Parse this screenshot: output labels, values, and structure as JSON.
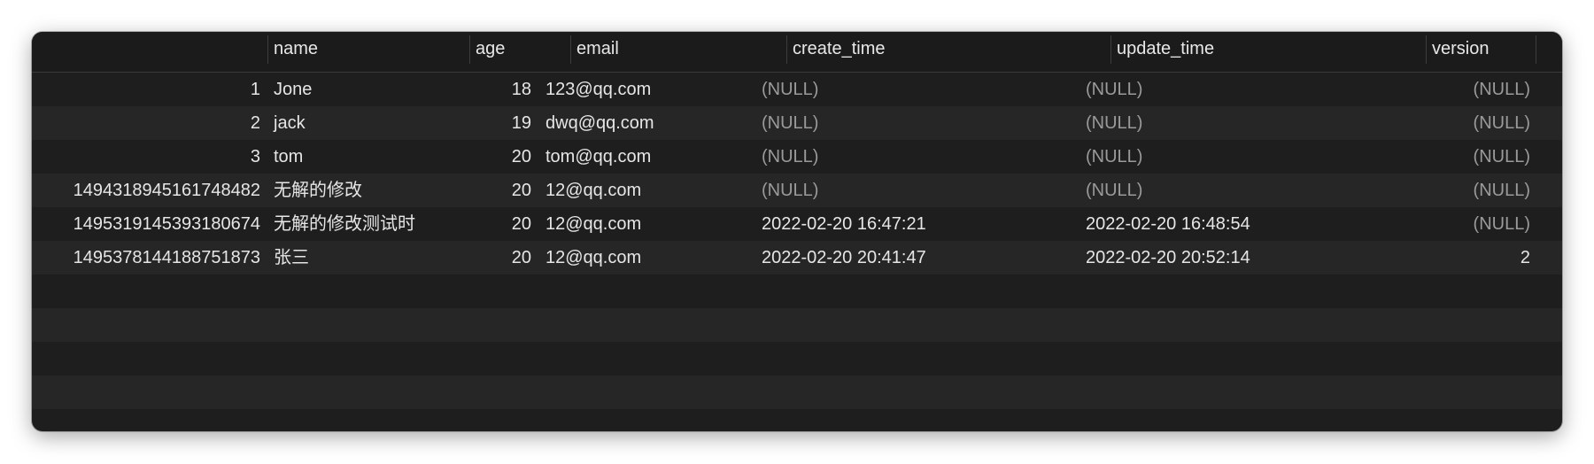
{
  "columns": [
    "",
    "name",
    "age",
    "email",
    "create_time",
    "update_time",
    "version"
  ],
  "rows": [
    {
      "id": "1",
      "name": "Jone",
      "age": "18",
      "email": "123@qq.com",
      "create_time": "(NULL)",
      "update_time": "(NULL)",
      "version": "(NULL)"
    },
    {
      "id": "2",
      "name": "jack",
      "age": "19",
      "email": "dwq@qq.com",
      "create_time": "(NULL)",
      "update_time": "(NULL)",
      "version": "(NULL)"
    },
    {
      "id": "3",
      "name": "tom",
      "age": "20",
      "email": "tom@qq.com",
      "create_time": "(NULL)",
      "update_time": "(NULL)",
      "version": "(NULL)"
    },
    {
      "id": "1494318945161748482",
      "name": "无解的修改",
      "age": "20",
      "email": "12@qq.com",
      "create_time": "(NULL)",
      "update_time": "(NULL)",
      "version": "(NULL)"
    },
    {
      "id": "1495319145393180674",
      "name": "无解的修改测试时",
      "age": "20",
      "email": "12@qq.com",
      "create_time": "2022-02-20 16:47:21",
      "update_time": "2022-02-20 16:48:54",
      "version": "(NULL)"
    },
    {
      "id": "1495378144188751873",
      "name": "张三",
      "age": "20",
      "email": "12@qq.com",
      "create_time": "2022-02-20 20:41:47",
      "update_time": "2022-02-20 20:52:14",
      "version": "2"
    }
  ],
  "colors": {
    "background": "#1e1e1e",
    "alt_row": "#262626",
    "text": "#e6e6e6",
    "null_text": "#9a9a9a"
  }
}
